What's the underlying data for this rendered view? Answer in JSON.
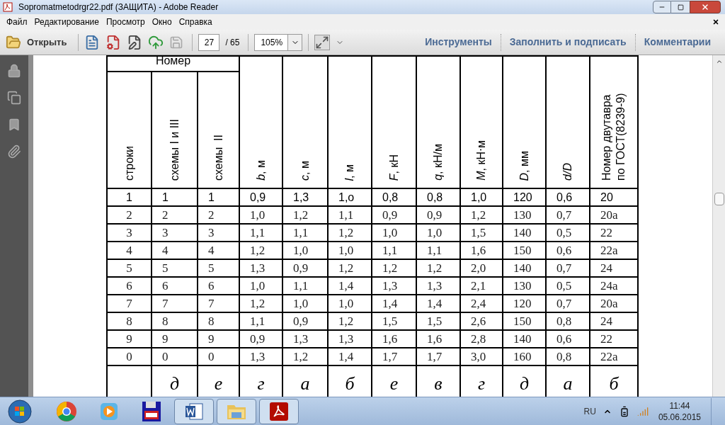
{
  "window": {
    "title": "Sopromatmetodrgr22.pdf (ЗАЩИТА) - Adobe Reader"
  },
  "menu": [
    "Файл",
    "Редактирование",
    "Просмотр",
    "Окно",
    "Справка"
  ],
  "toolbar": {
    "open": "Открыть",
    "page": "27",
    "page_total": "/ 65",
    "zoom": "105%",
    "panels": [
      "Инструменты",
      "Заполнить и подписать",
      "Комментарии"
    ]
  },
  "table": {
    "group_header": "Номер",
    "columns": [
      "строки",
      "схемы I и III",
      "схемы  II",
      "*b*,  м",
      "*c*,  м",
      "*l*,  м",
      "*F*,  кН",
      "*q*,  кН/м",
      "*M*,  кН⋅м",
      "*D*,  мм",
      "*d/D*",
      "Номер двутавра по ГОСТ(8239-9)"
    ],
    "rows": [
      {
        "bold": true,
        "cells": [
          "1",
          "1",
          "1",
          "0,9",
          "1,3",
          "1,о",
          "0,8",
          "0,8",
          "1,0",
          "120",
          "0,6",
          "20"
        ]
      },
      {
        "bold": false,
        "cells": [
          "2",
          "2",
          "2",
          "1,0",
          "1,2",
          "1,1",
          "0,9",
          "0,9",
          "1,2",
          "130",
          "0,7",
          "20а"
        ]
      },
      {
        "bold": false,
        "cells": [
          "3",
          "3",
          "3",
          "1,1",
          "1,1",
          "1,2",
          "1,0",
          "1,0",
          "1,5",
          "140",
          "0,5",
          "22"
        ]
      },
      {
        "bold": false,
        "cells": [
          "4",
          "4",
          "4",
          "1,2",
          "1,0",
          "1,0",
          "1,1",
          "1,1",
          "1,6",
          "150",
          "0,6",
          "22а"
        ]
      },
      {
        "bold": false,
        "cells": [
          "5",
          "5",
          "5",
          "1,3",
          "0,9",
          "1,2",
          "1,2",
          "1,2",
          "2,0",
          "140",
          "0,7",
          "24"
        ]
      },
      {
        "bold": false,
        "cells": [
          "6",
          "6",
          "6",
          "1,0",
          "1,1",
          "1,4",
          "1,3",
          "1,3",
          "2,1",
          "130",
          "0,5",
          "24а"
        ]
      },
      {
        "bold": false,
        "cells": [
          "7",
          "7",
          "7",
          "1,2",
          "1,0",
          "1,0",
          "1,4",
          "1,4",
          "2,4",
          "120",
          "0,7",
          "20а"
        ]
      },
      {
        "bold": false,
        "cells": [
          "8",
          "8",
          "8",
          "1,1",
          "0,9",
          "1,2",
          "1,5",
          "1,5",
          "2,6",
          "150",
          "0,8",
          "24"
        ]
      },
      {
        "bold": false,
        "cells": [
          "9",
          "9",
          "9",
          "0,9",
          "1,3",
          "1,3",
          "1,6",
          "1,6",
          "2,8",
          "140",
          "0,6",
          "22"
        ]
      },
      {
        "bold": false,
        "cells": [
          "0",
          "0",
          "0",
          "1,3",
          "1,2",
          "1,4",
          "1,7",
          "1,7",
          "3,0",
          "160",
          "0,8",
          "22а"
        ]
      }
    ],
    "letters": [
      "д",
      "е",
      "г",
      "а",
      "б",
      "е",
      "в",
      "г",
      "д",
      "а",
      "б"
    ]
  },
  "taskbar": {
    "apps": [
      {
        "kind": "chrome",
        "selected": false
      },
      {
        "kind": "media",
        "selected": false
      },
      {
        "kind": "floppy",
        "selected": false
      },
      {
        "kind": "word",
        "selected": true
      },
      {
        "kind": "explorer",
        "selected": true
      },
      {
        "kind": "acrobat",
        "selected": true
      }
    ],
    "language": "RU",
    "time": "11:44",
    "date": "05.06.2015"
  }
}
